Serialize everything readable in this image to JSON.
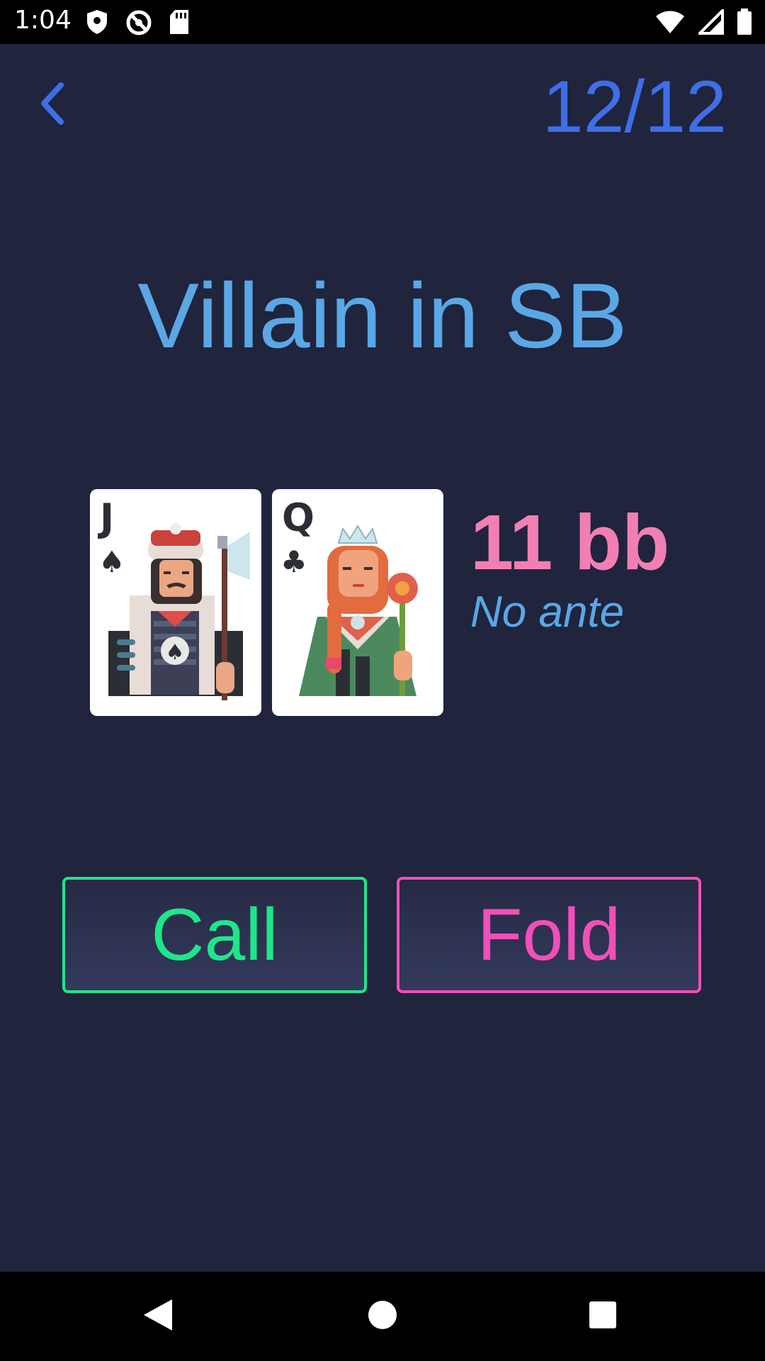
{
  "status_bar": {
    "time": "1:04",
    "left_icons": [
      "shield-icon",
      "no-disturb-icon",
      "sd-card-icon"
    ],
    "right_icons": [
      "wifi-icon",
      "signal-icon",
      "battery-icon"
    ]
  },
  "header": {
    "back_icon": "chevron-left-icon",
    "progress": "12/12"
  },
  "title": "Villain in SB",
  "hand": {
    "cards": [
      {
        "rank": "J",
        "suit": "♠",
        "suit_name": "spades",
        "icon": "jack-of-spades-icon"
      },
      {
        "rank": "Q",
        "suit": "♣",
        "suit_name": "clubs",
        "icon": "queen-of-clubs-icon"
      }
    ],
    "stack": "11 bb",
    "ante": "No ante"
  },
  "actions": {
    "call_label": "Call",
    "fold_label": "Fold"
  },
  "colors": {
    "background": "#20243d",
    "accent_blue": "#3f6ee6",
    "title_blue": "#5aa7e6",
    "stack_pink": "#f27fb3",
    "call_green": "#1ee68a",
    "fold_pink": "#f14fb9"
  },
  "nav_bar": {
    "icons": [
      "back-triangle-icon",
      "home-circle-icon",
      "recents-square-icon"
    ]
  }
}
